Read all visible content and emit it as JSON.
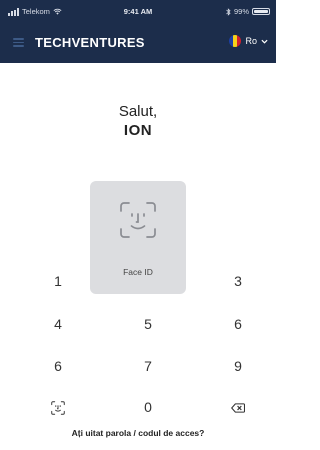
{
  "status_bar": {
    "carrier": "Telekom",
    "time": "9:41 AM",
    "battery_percent": "99%"
  },
  "header": {
    "brand": "TECHVENTURES",
    "language": "Ro",
    "background_color": "#1c2d4b"
  },
  "greeting": {
    "hello": "Salut,",
    "name": "ION"
  },
  "face_id": {
    "label": "Face ID",
    "icon": "face-id-icon"
  },
  "keypad": {
    "k1": "1",
    "k3": "3",
    "k4": "4",
    "k5": "5",
    "k6": "6",
    "k6b": "6",
    "k7": "7",
    "k9": "9",
    "k0": "0",
    "biometric_icon": "face-id-icon",
    "backspace_icon": "backspace-icon"
  },
  "forgot_link": "Ați uitat parola / codul de acces?"
}
